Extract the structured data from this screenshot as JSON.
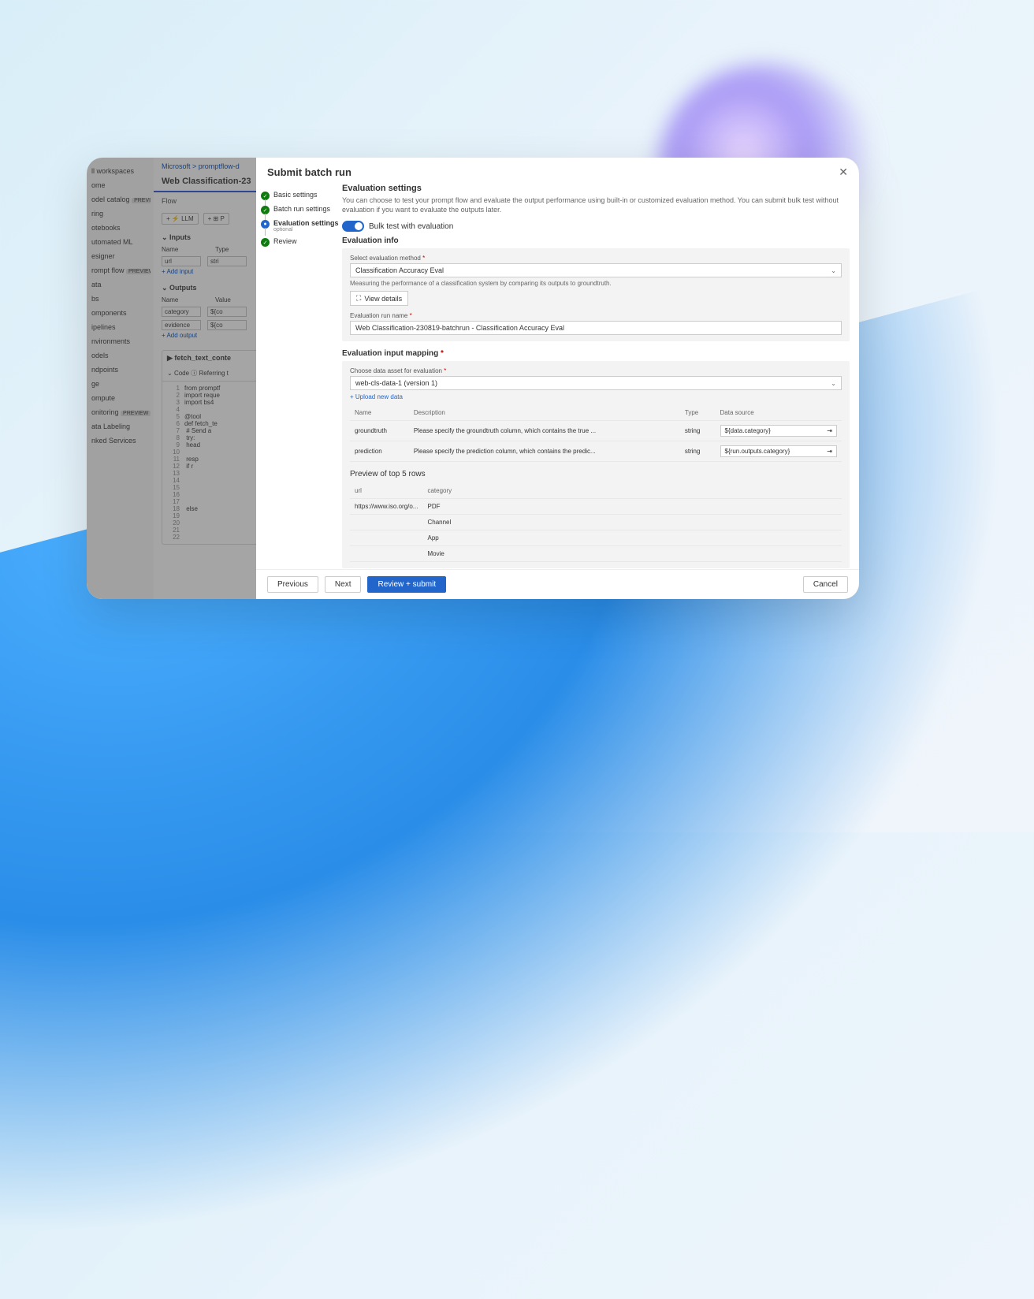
{
  "background": {
    "sidebar": [
      "ll workspaces",
      "ome",
      "odel catalog",
      "ring",
      "otebooks",
      "utomated ML",
      "esigner",
      "rompt flow",
      "ata",
      "bs",
      "omponents",
      "ipelines",
      "nvironments",
      "odels",
      "ndpoints",
      "ge",
      "ompute",
      "onitoring",
      "ata Labeling",
      "nked Services"
    ],
    "crumbs": "Microsoft  >  promptflow-d",
    "title": "Web Classification-23",
    "tab": "Flow",
    "tool_llm": "LLM",
    "tool_p": "P",
    "inputs_head": "Inputs",
    "inputs_name": "Name",
    "inputs_type": "Type",
    "inputs_row_name": "url",
    "inputs_row_type": "stri",
    "add_input": "+ Add input",
    "outputs_head": "Outputs",
    "outputs_name": "Name",
    "outputs_value": "Value",
    "out1_name": "category",
    "out1_val": "${co",
    "out2_name": "evidence",
    "out2_val": "${co",
    "add_output": "+ Add output",
    "code_title": "fetch_text_conte",
    "code_tab": "Code   ⓘ Referring t",
    "code_lines": [
      "from promptf",
      "import reque",
      "import bs4",
      "",
      "@tool",
      "def fetch_te",
      "    # Send a",
      "    try:",
      "        head",
      "",
      "        resp",
      "        if r",
      "",
      "",
      "",
      "",
      "",
      "        else",
      "",
      "",
      "",
      ""
    ]
  },
  "modal": {
    "title": "Submit batch run",
    "steps": [
      {
        "label": "Basic settings",
        "state": "done"
      },
      {
        "label": "Batch run settings",
        "state": "done"
      },
      {
        "label": "Evaluation settings",
        "optional": "optional",
        "state": "current"
      },
      {
        "label": "Review",
        "state": "done"
      }
    ],
    "heading": "Evaluation settings",
    "desc": "You can choose to test your prompt flow and evaluate the output performance using built-in or customized evaluation method. You can submit bulk test without evaluation if you want to evaluate the outputs later.",
    "toggle_label": "Bulk test with evaluation",
    "info_heading": "Evaluation info",
    "select_label": "Select evaluation method",
    "select_value": "Classification Accuracy Eval",
    "select_desc": "Measuring the performance of a classification system by comparing its outputs to groundtruth.",
    "view_details": "View details",
    "run_name_label": "Evaluation run name",
    "run_name_value": "Web Classification-230819-batchrun - Classification Accuracy Eval",
    "mapping_heading": "Evaluation input mapping",
    "asset_label": "Choose data asset for evaluation",
    "asset_value": "web-cls-data-1 (version 1)",
    "upload_link": "Upload new data",
    "map_cols": {
      "c1": "Name",
      "c2": "Description",
      "c3": "Type",
      "c4": "Data source"
    },
    "map_rows": [
      {
        "name": "groundtruth",
        "desc": "Please specify the groundtruth column, which contains the true ...",
        "type": "string",
        "source": "${data.category}"
      },
      {
        "name": "prediction",
        "desc": "Please specify the prediction column, which contains the predic...",
        "type": "string",
        "source": "${run.outputs.category}"
      }
    ],
    "preview_heading": "Preview of top 5 rows",
    "preview_cols": {
      "c1": "url",
      "c2": "category"
    },
    "preview_rows": [
      {
        "url": "https://www.iso.org/o...",
        "category": "PDF"
      },
      {
        "url": "",
        "category": "Channel"
      },
      {
        "url": "",
        "category": "App"
      },
      {
        "url": "",
        "category": "Movie"
      }
    ],
    "footer": {
      "prev": "Previous",
      "next": "Next",
      "submit": "Review + submit",
      "cancel": "Cancel"
    }
  }
}
